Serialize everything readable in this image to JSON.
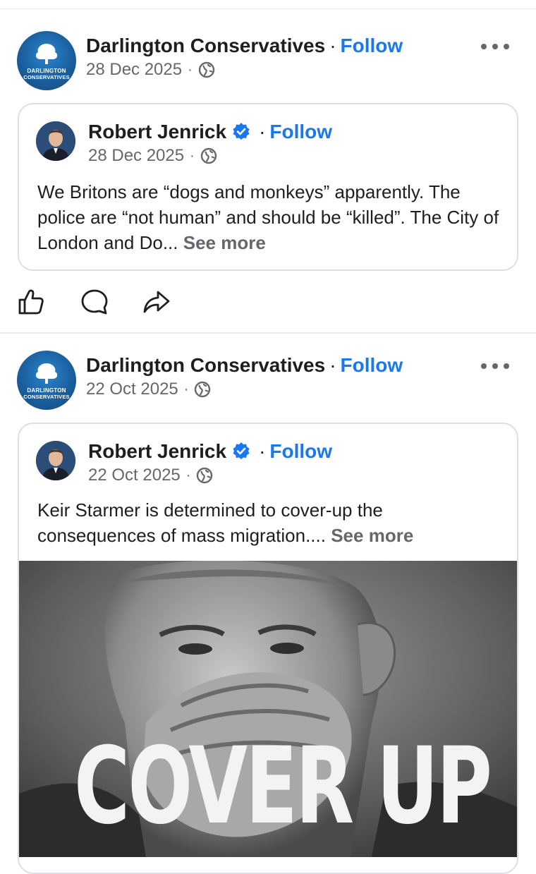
{
  "posts": [
    {
      "page_name": "Darlington Conservatives",
      "follow_label": "Follow",
      "date": "28 Dec 2025",
      "avatar_text_line1": "DARLINGTON",
      "avatar_text_line2": "CONSERVATIVES",
      "shared": {
        "author": "Robert Jenrick",
        "follow_label": "Follow",
        "date": "28 Dec 2025",
        "text": "We Britons are “dogs and monkeys” apparently. The police are “not human” and should be “killed”. The City of London and Do...",
        "see_more": "See more"
      }
    },
    {
      "page_name": "Darlington Conservatives",
      "follow_label": "Follow",
      "date": "22 Oct 2025",
      "avatar_text_line1": "DARLINGTON",
      "avatar_text_line2": "CONSERVATIVES",
      "shared": {
        "author": "Robert Jenrick",
        "follow_label": "Follow",
        "date": "22 Oct 2025",
        "text": "Keir Starmer is determined to cover-up the consequences of mass migration....",
        "see_more": "See more",
        "image_overlay_text": "COVER UP"
      }
    }
  ],
  "icons": {
    "like": "thumbs-up-icon",
    "comment": "comment-icon",
    "share": "share-icon",
    "more": "more-options-icon",
    "audience": "globe-icon",
    "verified": "verified-badge-icon"
  },
  "colors": {
    "link_blue": "#1877f2",
    "secondary_text": "#65676b",
    "verified_blue": "#1877f2"
  }
}
